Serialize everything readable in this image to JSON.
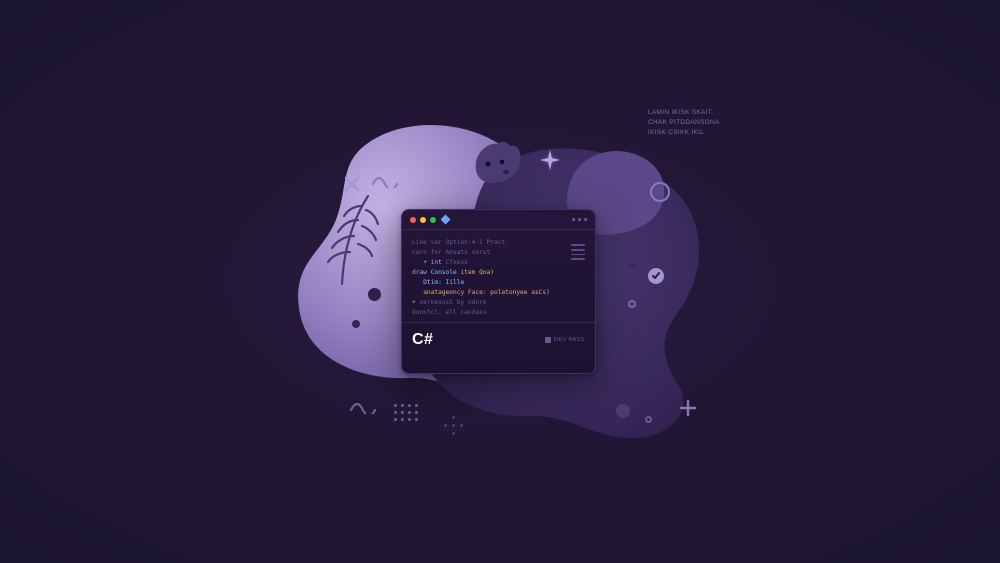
{
  "colors": {
    "bg": "#1c1530",
    "blob_light": "#a08cc9",
    "blob_mid": "#5b4685",
    "blob_dark": "#3a2b5c",
    "accent": "#a692d4",
    "text_dim": "#7d6ba0"
  },
  "window": {
    "lang_label": "C#",
    "footer_label": "DEV PASS",
    "code_lines": [
      {
        "indent": 0,
        "seg_cm": "Line var Option:4-1 Pract.",
        "seg_kw": "",
        "seg_fn": "",
        "seg_str": "",
        "seg_num": ""
      },
      {
        "indent": 0,
        "seg_cm": "carn for Ansats sorst",
        "seg_kw": "",
        "seg_fn": "",
        "seg_str": "",
        "seg_num": ""
      },
      {
        "indent": 1,
        "seg_kw": "+ int",
        "seg_cm": " Cfxess",
        "seg_fn": "",
        "seg_str": "",
        "seg_num": ""
      },
      {
        "indent": 0,
        "seg_kw": "draw",
        "seg_fn": " Console",
        "seg_str": " item",
        "seg_num": " Qoa)",
        "seg_cm": ""
      },
      {
        "indent": 1,
        "seg_fn": "Dtim: Iille",
        "seg_kw": "",
        "seg_cm": "",
        "seg_str": "",
        "seg_num": ""
      },
      {
        "indent": 1,
        "seg_str": "anatageoncy Face: polatonyee asCs)",
        "seg_kw": "",
        "seg_fn": "",
        "seg_cm": "",
        "seg_num": ""
      },
      {
        "indent": 0,
        "seg_kw": "+",
        "seg_cm": " xeroesost by odore",
        "seg_fn": "",
        "seg_str": "",
        "seg_num": ""
      },
      {
        "indent": 0,
        "seg_cm": "donxtcl. ell candass",
        "seg_kw": "",
        "seg_fn": "",
        "seg_str": "",
        "seg_num": ""
      }
    ]
  },
  "caption": {
    "line1": "LAMIN IKISK SKAIT.",
    "line2": "CHAK PITDDANSONA",
    "line3": "IKISK CSIKK IKIL"
  },
  "icons": {
    "diamond": "diamond",
    "hamburger": "hamburger",
    "checkmark": "check",
    "sparkle": "sparkle",
    "cross": "cross",
    "plus": "plus",
    "wave": "wave"
  }
}
